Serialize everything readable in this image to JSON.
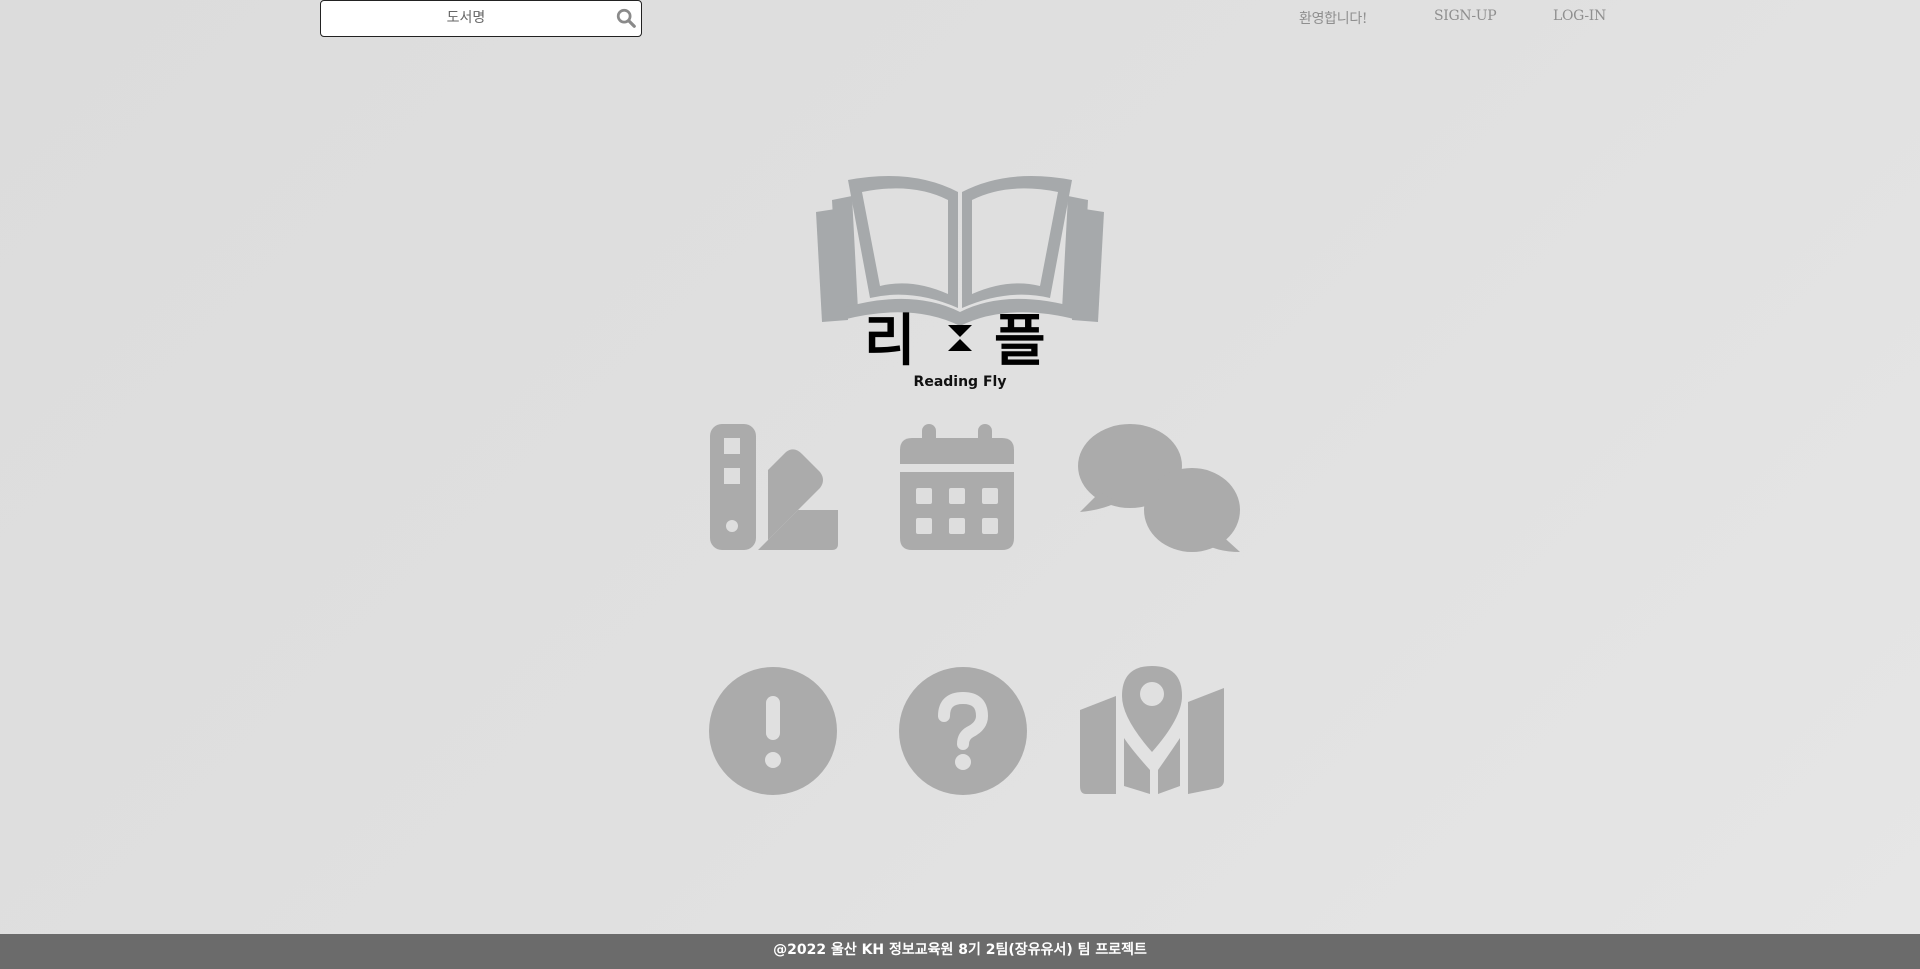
{
  "header": {
    "search": {
      "placeholder": "도서명",
      "value": "",
      "icon": "search-icon"
    },
    "welcome_text": "환영합니다!",
    "signup_label": "SIGN-UP",
    "login_label": "LOG-IN"
  },
  "logo": {
    "title": "리플",
    "subtitle": "Reading Fly",
    "icon": "open-book-icon"
  },
  "menu": {
    "items": [
      {
        "icon": "swatchbook-icon"
      },
      {
        "icon": "calendar-icon"
      },
      {
        "icon": "chat-bubbles-icon"
      },
      {
        "icon": "exclamation-circle-icon"
      },
      {
        "icon": "question-circle-icon"
      },
      {
        "icon": "map-location-icon"
      }
    ]
  },
  "footer": {
    "text": "@2022 울산 KH 정보교육원 8기 2팀(장유유서) 팀 프로젝트"
  },
  "colors": {
    "icon_gray": "#ababab",
    "logo_gray": "#a6a9ab",
    "footer_bg": "#6b6b6b",
    "nav_text": "#8f8f8f"
  }
}
